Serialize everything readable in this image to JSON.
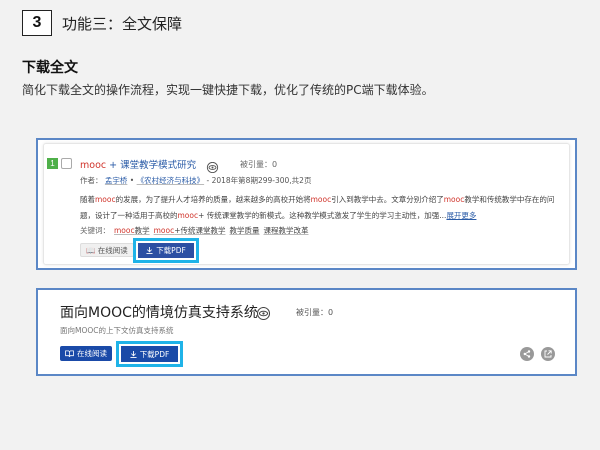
{
  "section": {
    "number": "3",
    "title": "功能三：全文保障"
  },
  "feature": {
    "title": "下载全文",
    "description": "简化下载全文的操作流程，实现一键快捷下载，优化了传统的PC端下载体验。"
  },
  "result1": {
    "index": "1",
    "title_highlight": "mooc",
    "title_rest": "+ 课堂教学模式研究",
    "cite_label": "被引量：",
    "cite_count": "0",
    "author_label": "作者：",
    "author": "孟宇桥",
    "journal": "《农村经济与科技》",
    "issue": "- 2018年第8期299-300,共2页",
    "abstract": [
      {
        "t": "随着"
      },
      {
        "t": "mooc",
        "h": true
      },
      {
        "t": "的发展，为了提升人才培养的质量，越来越多的高校开始将"
      },
      {
        "t": "mooc",
        "h": true
      },
      {
        "t": "引入到教学中去。文章分别介绍了"
      },
      {
        "t": "mooc",
        "h": true
      },
      {
        "t": "教学和传统教学中存在的问题，设计了一种适用于高校的"
      },
      {
        "t": "mooc",
        "h": true
      },
      {
        "t": "+ 传统课堂教学的新模式。这种教学模式激发了学生的学习主动性，加强..."
      }
    ],
    "more": "展开更多",
    "keywords_label": "关键词：",
    "keywords": [
      {
        "h": "mooc",
        "r": "教学"
      },
      {
        "h": "mooc",
        "r": "+传统课堂教学"
      },
      {
        "h": "",
        "r": "教学质量"
      },
      {
        "h": "",
        "r": "课程教学改革"
      }
    ],
    "read_label": "在线阅读",
    "download_label": "下载PDF"
  },
  "result2": {
    "title": "面向MOOC的情境仿真支持系统",
    "cite_label": "被引量：",
    "cite_count": "0",
    "subtitle": "面向MOOC的上下文仿真支持系统",
    "read_label": "在线阅读",
    "download_label": "下载PDF",
    "share_icon": "share-icon",
    "open_icon": "external-link-icon"
  },
  "colors": {
    "card_border": "#5b87c6",
    "highlight_frame": "#1fb3e8",
    "link_blue": "#2a5ba7",
    "keyword_red": "#d0332a",
    "button_blue": "#1a4aa8"
  }
}
